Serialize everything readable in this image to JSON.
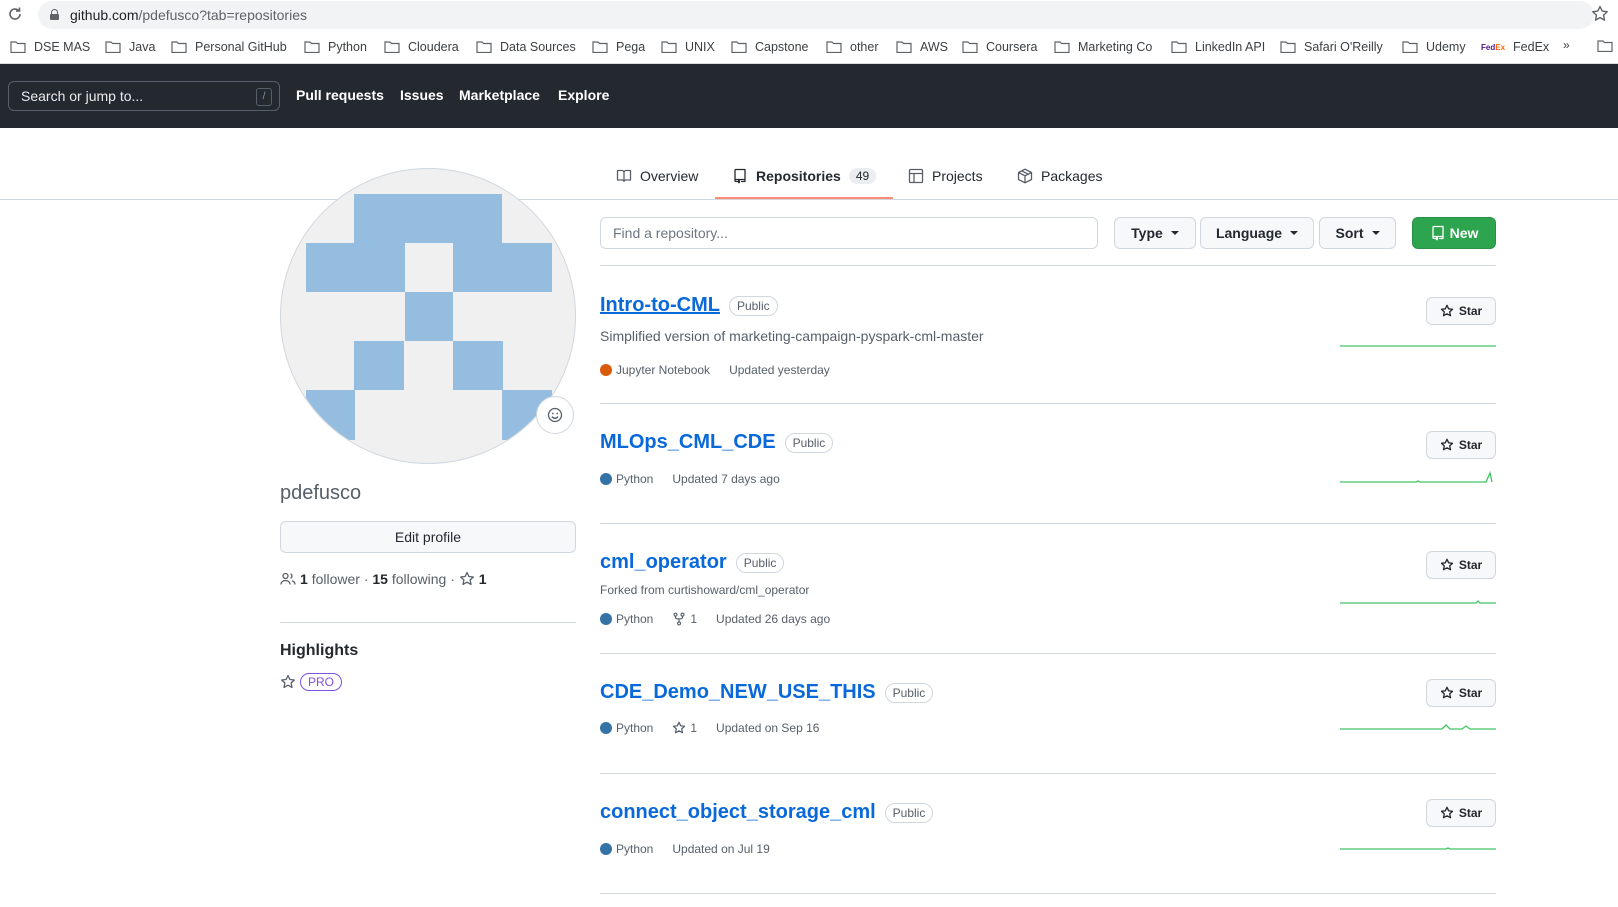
{
  "browser": {
    "url_domain": "github.com",
    "url_path": "/pdefusco?tab=repositories",
    "bookmarks": [
      "DSE MAS",
      "Java",
      "Personal GitHub",
      "Python",
      "Cloudera",
      "Data Sources",
      "Pega",
      "UNIX",
      "Capstone",
      "other",
      "AWS",
      "Coursera",
      "Marketing Co",
      "LinkedIn API",
      "Safari O'Reilly",
      "Udemy",
      "FedEx"
    ],
    "bookmarks_more": "»"
  },
  "header": {
    "search_placeholder": "Search or jump to...",
    "search_key": "/",
    "nav": [
      "Pull requests",
      "Issues",
      "Marketplace",
      "Explore"
    ]
  },
  "tabs": [
    {
      "label": "Overview",
      "icon": "book-icon"
    },
    {
      "label": "Repositories",
      "icon": "repo-icon",
      "count": "49",
      "active": true
    },
    {
      "label": "Projects",
      "icon": "table-icon"
    },
    {
      "label": "Packages",
      "icon": "package-icon"
    }
  ],
  "profile": {
    "username": "pdefusco",
    "edit_label": "Edit profile",
    "followers_count": "1",
    "followers_label": "follower",
    "following_count": "15",
    "following_label": "following",
    "stars_count": "1",
    "highlights_title": "Highlights",
    "pro_label": "PRO",
    "avatar_color": "#95bde0"
  },
  "filters": {
    "find_placeholder": "Find a repository...",
    "type_label": "Type",
    "language_label": "Language",
    "sort_label": "Sort",
    "new_label": "New"
  },
  "repos": [
    {
      "name": "Intro-to-CML",
      "visibility": "Public",
      "description": "Simplified version of marketing-campaign-pyspark-cml-master",
      "language": "Jupyter Notebook",
      "language_color": "#DA5B0B",
      "updated": "Updated yesterday",
      "star_label": "Star"
    },
    {
      "name": "MLOps_CML_CDE",
      "visibility": "Public",
      "language": "Python",
      "language_color": "#3572A5",
      "updated": "Updated 7 days ago",
      "star_label": "Star"
    },
    {
      "name": "cml_operator",
      "visibility": "Public",
      "forked_from": "Forked from curtishoward/cml_operator",
      "language": "Python",
      "language_color": "#3572A5",
      "forks": "1",
      "updated": "Updated 26 days ago",
      "star_label": "Star"
    },
    {
      "name": "CDE_Demo_NEW_USE_THIS",
      "visibility": "Public",
      "language": "Python",
      "language_color": "#3572A5",
      "stars": "1",
      "updated": "Updated on Sep 16",
      "star_label": "Star"
    },
    {
      "name": "connect_object_storage_cml",
      "visibility": "Public",
      "language": "Python",
      "language_color": "#3572A5",
      "updated": "Updated on Jul 19",
      "star_label": "Star"
    }
  ],
  "colors": {
    "header_bg": "#24292f",
    "link": "#0969da",
    "primary_button": "#2da44e",
    "tab_underline": "#fd8c73",
    "sparkline": "#40c463"
  }
}
